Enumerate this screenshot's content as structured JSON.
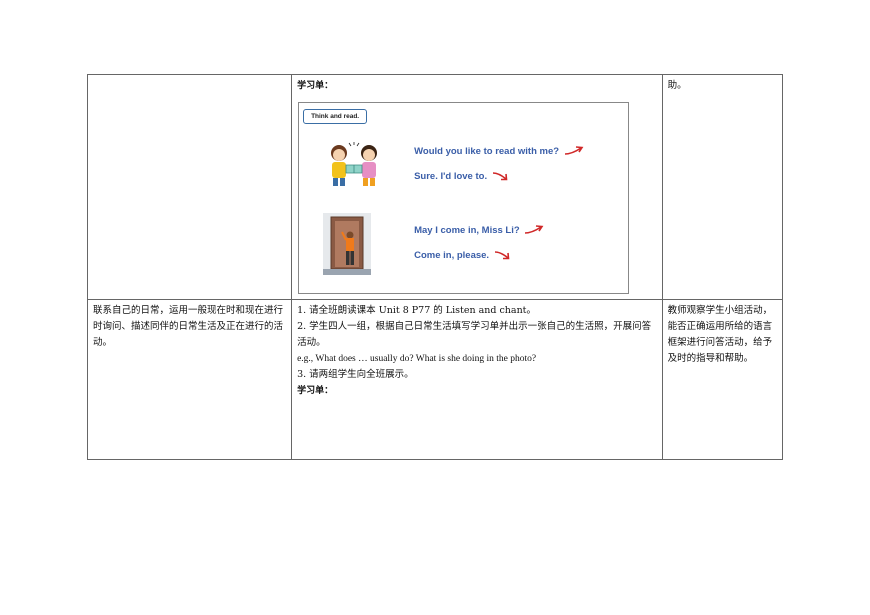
{
  "table": {
    "row1": {
      "col2_heading": "学习单：",
      "col3_text": "助。",
      "worksheet": {
        "tag": "Think and read.",
        "dialogue": [
          "Would you like to read with me?",
          "Sure. I'd love to.",
          "May I come in, Miss Li?",
          "Come in, please."
        ]
      }
    },
    "row2": {
      "col1_text": "联系自己的日常，运用一般现在时和现在进行时询问、描述同伴的日常生活及正在进行的活动。",
      "steps": [
        "1.  请全班朗读课本 Unit 8 P77 的 Listen and chant。",
        "2.  学生四人一组，根据自己日常生活填写学习单并出示一张自己的生活照，开展问答活动。",
        "e.g., What does … usually do? What is she doing in the photo?",
        "3.  请两组学生向全班展示。"
      ],
      "worksheet_heading": "学习单：",
      "col3_text": "教师观察学生小组活动，能否正确运用所给的语言框架进行问答活动，给予及时的指导和帮助。"
    }
  },
  "colors": {
    "dialogue": "#3a5ea8",
    "arrow": "#d02828",
    "border": "#666666"
  }
}
